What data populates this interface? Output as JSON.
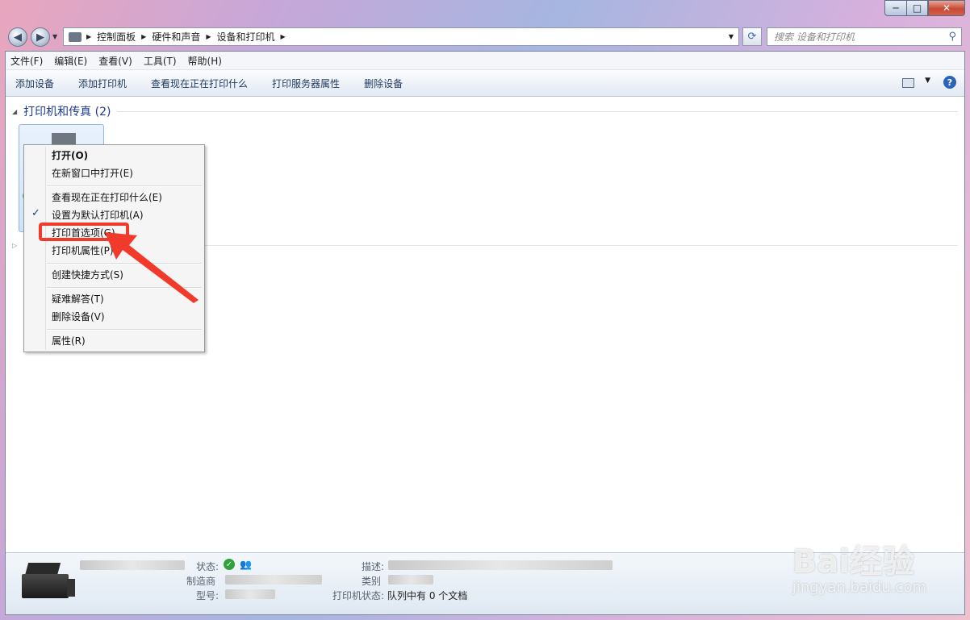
{
  "window": {
    "caption": {
      "minimize": "─",
      "maximize": "□",
      "close": "✕"
    }
  },
  "address": {
    "crumbs": [
      "控制面板",
      "硬件和声音",
      "设备和打印机"
    ],
    "search_placeholder": "搜索 设备和打印机"
  },
  "menubar": [
    "文件(F)",
    "编辑(E)",
    "查看(V)",
    "工具(T)",
    "帮助(H)"
  ],
  "toolbar": [
    "添加设备",
    "添加打印机",
    "查看现在正在打印什么",
    "打印服务器属性",
    "删除设备"
  ],
  "group": {
    "title": "打印机和传真 (2)"
  },
  "context_menu": {
    "items": [
      {
        "label": "打开(O)",
        "bold": true
      },
      {
        "label": "在新窗口中打开(E)"
      },
      {
        "label": "查看现在正在打印什么(E)"
      },
      {
        "label": "设置为默认打印机(A)",
        "checked": true
      },
      {
        "label": "打印首选项(G)",
        "highlighted": true
      },
      {
        "label": "打印机属性(P)"
      },
      {
        "label": "创建快捷方式(S)"
      },
      {
        "label": "疑难解答(T)"
      },
      {
        "label": "删除设备(V)"
      },
      {
        "label": "属性(R)"
      }
    ],
    "highlight_color": "#f23a2a"
  },
  "details": {
    "status_label": "状态:",
    "manufacturer_label": "制造商",
    "model_label": "型号:",
    "description_label": "描述:",
    "category_label": "类别",
    "printer_status_label": "打印机状态:",
    "printer_status_value": "队列中有 0 个文档"
  },
  "watermark": {
    "brand": "Bai经验",
    "url": "jingyan.baidu.com"
  },
  "icons": [
    "back-arrow-icon",
    "forward-arrow-icon",
    "folder-icon",
    "refresh-icon",
    "search-icon",
    "help-icon",
    "printer-icon",
    "status-ok-icon",
    "users-icon"
  ]
}
